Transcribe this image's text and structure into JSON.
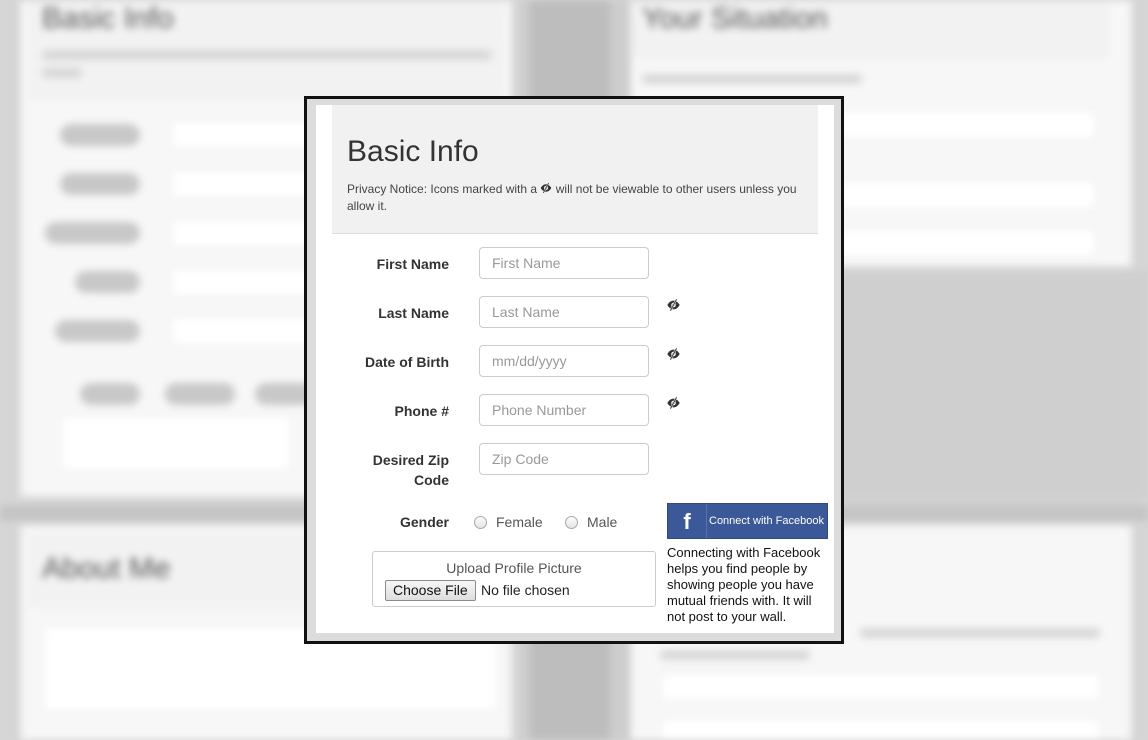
{
  "background": {
    "left_heading": "Basic Info",
    "right_heading": "Your Situation",
    "bottom_heading": "About Me"
  },
  "modal": {
    "title": "Basic Info",
    "privacy_prefix": "Privacy Notice: Icons marked with a",
    "privacy_suffix": "will not be viewable to other users unless you allow it.",
    "fields": {
      "first_name": {
        "label": "First Name",
        "placeholder": "First Name"
      },
      "last_name": {
        "label": "Last Name",
        "placeholder": "Last Name"
      },
      "dob": {
        "label": "Date of Birth",
        "placeholder": "mm/dd/yyyy"
      },
      "phone": {
        "label": "Phone #",
        "placeholder": "Phone Number"
      },
      "zip": {
        "label_line1": "Desired Zip",
        "label_line2": "Code",
        "placeholder": "Zip Code"
      }
    },
    "gender": {
      "label": "Gender",
      "options": [
        "Female",
        "Male"
      ]
    },
    "upload": {
      "title": "Upload Profile Picture",
      "button": "Choose File",
      "status": "No file chosen"
    },
    "facebook": {
      "logo": "f",
      "button": "Connect with Facebook",
      "description": "Connecting with Facebook helps you find people by showing people you have mutual friends with. It will not post to your wall."
    },
    "icons": {
      "private": "eye-slash-icon"
    }
  }
}
